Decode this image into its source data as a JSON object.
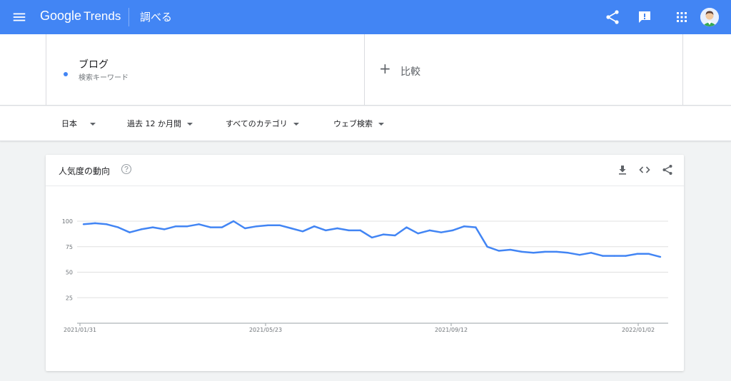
{
  "header": {
    "logo_google": "Google",
    "logo_trends": "Trends",
    "explore_label": "調べる",
    "icons": [
      "menu-icon",
      "share-icon",
      "feedback-icon",
      "apps-icon",
      "avatar"
    ]
  },
  "terms": {
    "term_name": "ブログ",
    "term_type": "検索キーワード",
    "term_color": "#4285f4",
    "compare_label": "比較"
  },
  "filters": {
    "region": "日本",
    "time_range": "過去 12 か月間",
    "category": "すべてのカテゴリ",
    "search_type": "ウェブ検索"
  },
  "card": {
    "title": "人気度の動向",
    "icons": [
      "help-icon",
      "download-icon",
      "embed-icon",
      "share-icon"
    ]
  },
  "chart_data": {
    "type": "line",
    "title": "人気度の動向",
    "xlabel": "",
    "ylabel": "",
    "ylim": [
      0,
      100
    ],
    "y_ticks": [
      25,
      50,
      75,
      100
    ],
    "x_tick_labels": [
      "2021/01/31",
      "2021/05/23",
      "2021/09/12",
      "2022/01/02"
    ],
    "grid": true,
    "line_color": "#4285f4",
    "series": [
      {
        "values": [
          97,
          98,
          97,
          94,
          89,
          92,
          94,
          92,
          95,
          95,
          97,
          94,
          94,
          100,
          93,
          95,
          96,
          96,
          93,
          90,
          95,
          91,
          93,
          91,
          91,
          84,
          87,
          86,
          94,
          88,
          91,
          89,
          91,
          95,
          94,
          75,
          71,
          72,
          70,
          69,
          70,
          70,
          69,
          67,
          69,
          66,
          66,
          66,
          68,
          68,
          65
        ]
      }
    ]
  }
}
